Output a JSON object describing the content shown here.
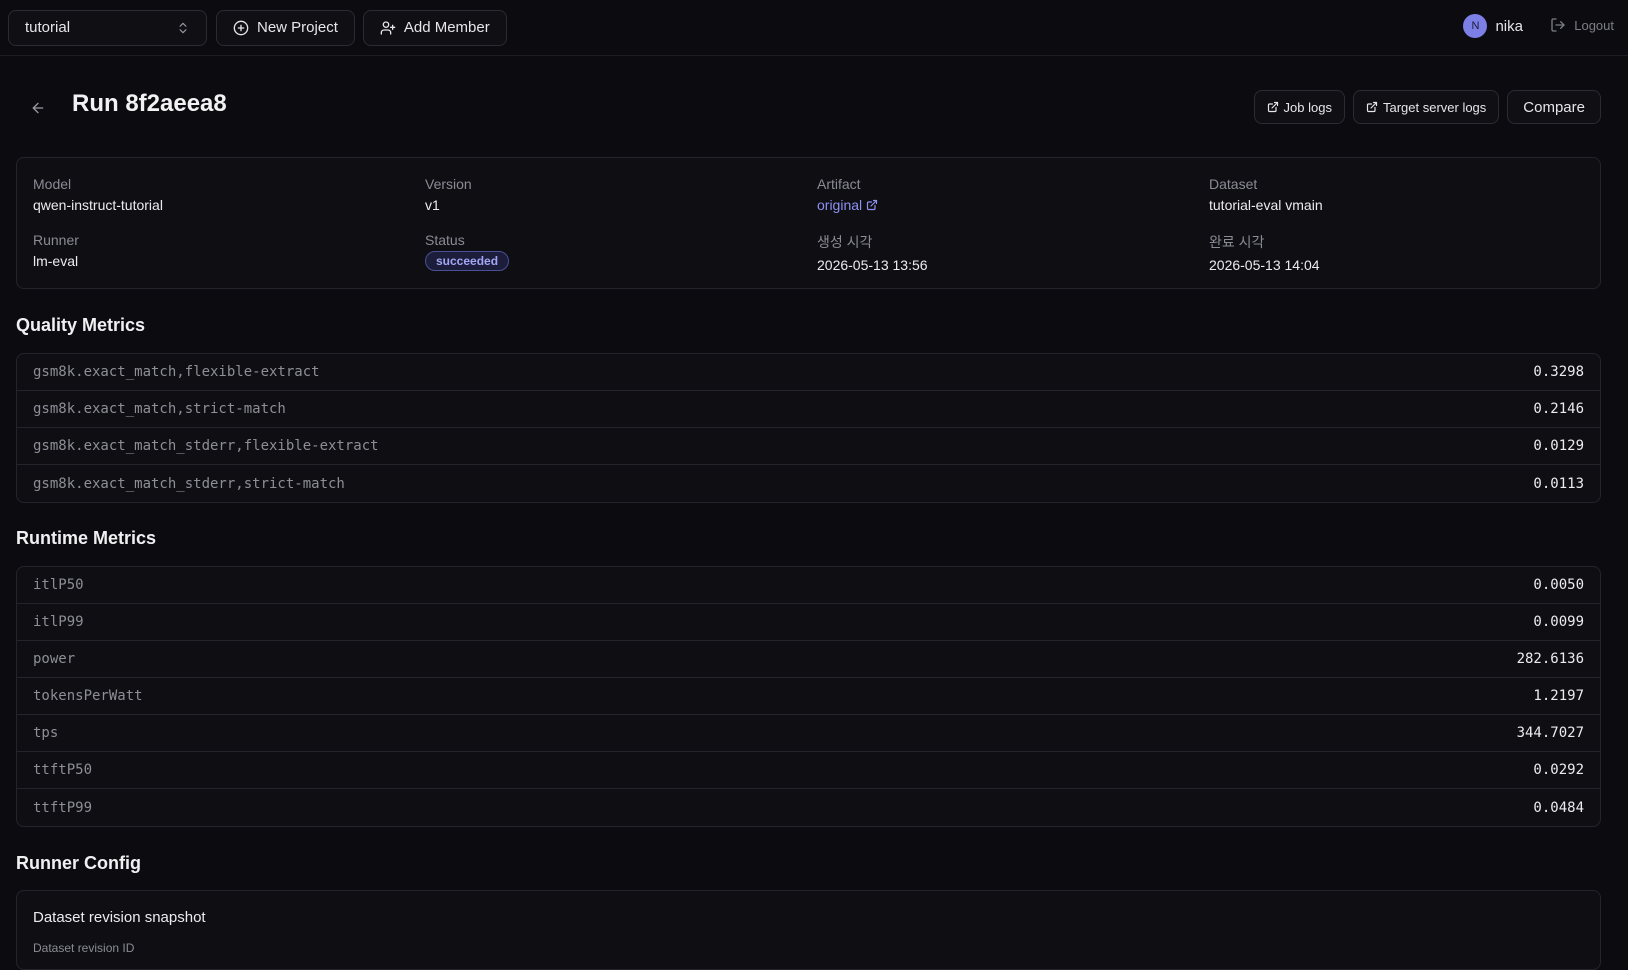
{
  "topbar": {
    "project": "tutorial",
    "new_project": "New Project",
    "add_member": "Add Member",
    "user_initial": "N",
    "username": "nika",
    "logout": "Logout"
  },
  "header": {
    "title": "Run 8f2aeea8",
    "job_logs": "Job logs",
    "target_logs": "Target server logs",
    "compare": "Compare"
  },
  "info": {
    "model_label": "Model",
    "model_value": "qwen-instruct-tutorial",
    "version_label": "Version",
    "version_value": "v1",
    "artifact_label": "Artifact",
    "artifact_value": "original",
    "dataset_label": "Dataset",
    "dataset_value": "tutorial-eval vmain",
    "runner_label": "Runner",
    "runner_value": "lm-eval",
    "status_label": "Status",
    "status_value": "succeeded",
    "created_label": "생성 시각",
    "created_value": "2026-05-13 13:56",
    "completed_label": "완료 시각",
    "completed_value": "2026-05-13 14:04"
  },
  "quality": {
    "title": "Quality Metrics",
    "rows": [
      {
        "key": "gsm8k.exact_match,flexible-extract",
        "value": "0.3298"
      },
      {
        "key": "gsm8k.exact_match,strict-match",
        "value": "0.2146"
      },
      {
        "key": "gsm8k.exact_match_stderr,flexible-extract",
        "value": "0.0129"
      },
      {
        "key": "gsm8k.exact_match_stderr,strict-match",
        "value": "0.0113"
      }
    ]
  },
  "runtime": {
    "title": "Runtime Metrics",
    "rows": [
      {
        "key": "itlP50",
        "value": "0.0050"
      },
      {
        "key": "itlP99",
        "value": "0.0099"
      },
      {
        "key": "power",
        "value": "282.6136"
      },
      {
        "key": "tokensPerWatt",
        "value": "1.2197"
      },
      {
        "key": "tps",
        "value": "344.7027"
      },
      {
        "key": "ttftP50",
        "value": "0.0292"
      },
      {
        "key": "ttftP99",
        "value": "0.0484"
      }
    ]
  },
  "config": {
    "title": "Runner Config",
    "card_title": "Dataset revision snapshot",
    "card_sub": "Dataset revision ID"
  },
  "icons": {
    "chevrons": "chevrons-up-down-icon",
    "plus": "plus-circle-icon",
    "user_plus": "user-plus-icon",
    "logout": "logout-icon",
    "back": "arrow-left-icon",
    "external": "external-link-icon"
  },
  "colors": {
    "background": "#0c0c10",
    "accent": "#8d91f2",
    "badge_bg": "#1c1d3a"
  }
}
